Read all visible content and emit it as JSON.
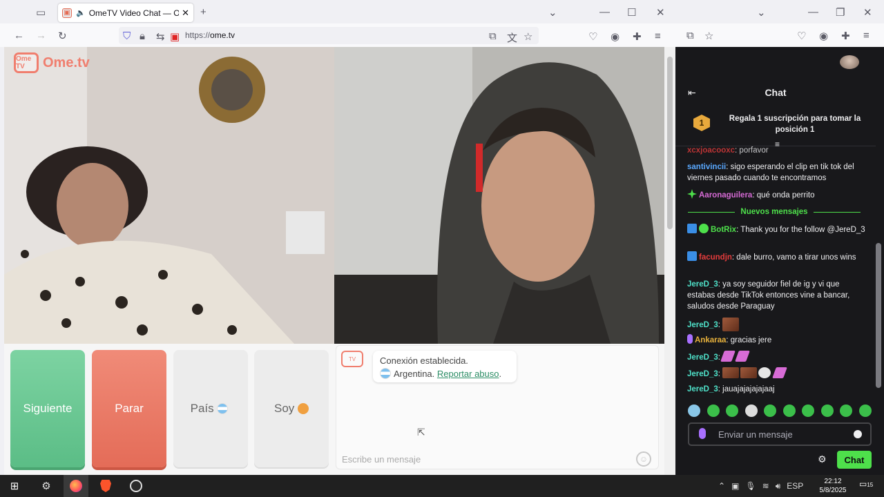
{
  "browser_left": {
    "tab_title": "OmeTV Video Chat — Ome",
    "url_scheme": "https://",
    "url_host": "ome.tv"
  },
  "ometv": {
    "logo_text": "Ome.tv",
    "logo_badge": "Ome TV",
    "buttons": {
      "next": "Siguiente",
      "stop": "Parar",
      "country": "País",
      "me": "Soy"
    },
    "chat": {
      "status": "Conexión establecida.",
      "country": "Argentina.",
      "report": "Reportar abuso",
      "report_suffix": ".",
      "input_placeholder": "Escribe un mensaje"
    }
  },
  "twitch": {
    "title": "Chat",
    "pinned": "Regala 1 suscripción para tomar la posición 1",
    "pinned_rank": "1",
    "new_messages_label": "Nuevos mensajes",
    "messages": [
      {
        "user": "xcxjoacooxc",
        "color": "#e63c3c",
        "text": ": porfavor"
      },
      {
        "user": "santivincii",
        "color": "#5aa9ff",
        "text": ": sigo esperando el clip en tik tok del viernes pasado cuando te encontramos"
      },
      {
        "user": "Aaronaguilera",
        "color": "#d76bd6",
        "text": ": qué onda perrito"
      },
      {
        "user": "BotRix",
        "color": "#4ee04b",
        "text": ": Thank you for the follow @JereD_3"
      },
      {
        "user": "facundjn",
        "color": "#e63c3c",
        "text": ": dale burro, vamo a tirar unos wins"
      },
      {
        "user": "JereD_3",
        "color": "#4ee0c8",
        "text": ": ya soy seguidor fiel de ig y vi que estabas desde TikTok entonces vine a bancar, saludos desde Paraguay"
      },
      {
        "user": "JereD_3",
        "color": "#4ee0c8",
        "text": ":"
      },
      {
        "user": "Ankaraa",
        "color": "#e8b23c",
        "text": ": gracias jere"
      },
      {
        "user": "JereD_3",
        "color": "#4ee0c8",
        "text": ":"
      },
      {
        "user": "JereD_3",
        "color": "#4ee0c8",
        "text": ":"
      },
      {
        "user": "JereD_3",
        "color": "#4ee0c8",
        "text": ": jauajajajajajaaj"
      }
    ],
    "input_placeholder": "Enviar un mensaje",
    "chat_button": "Chat"
  },
  "taskbar": {
    "language": "ESP",
    "time": "22:12",
    "date": "5/8/2025",
    "notification_count": "15"
  },
  "colors": {
    "next_green": "#5bbd86",
    "stop_red": "#e46c58",
    "twitch_green": "#4ee04b",
    "twitch_bg": "#18181b"
  }
}
